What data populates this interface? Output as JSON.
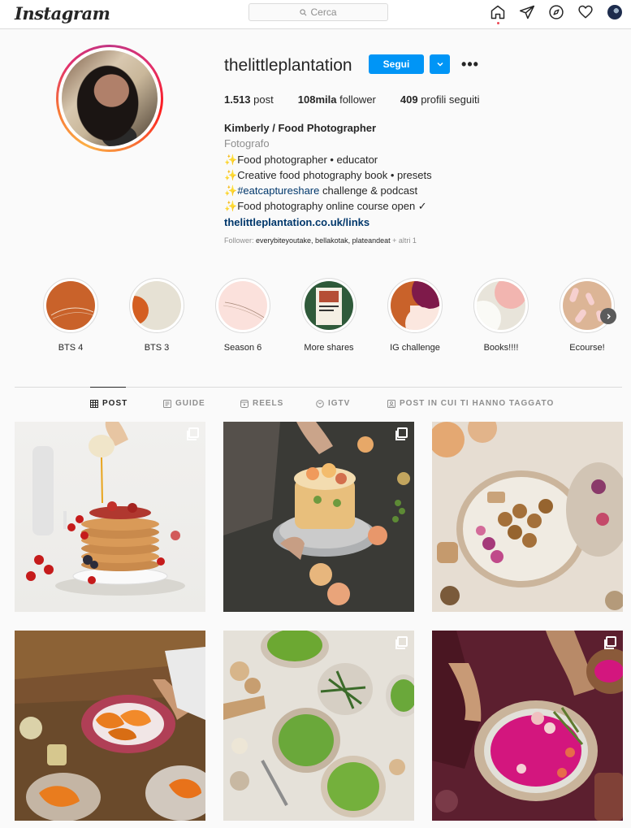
{
  "app": {
    "logo_text": "Instagram",
    "search_placeholder": "Cerca"
  },
  "nav": {
    "icons": [
      "home-icon",
      "direct-message-icon",
      "explore-icon",
      "activity-heart-icon",
      "profile-avatar"
    ]
  },
  "profile": {
    "username": "thelittleplantation",
    "follow_label": "Segui",
    "stats": {
      "posts_value": "1.513",
      "posts_label": "post",
      "followers_value": "108mila",
      "followers_label": "follower",
      "following_value": "409",
      "following_label": "profili seguiti"
    },
    "bio": {
      "name": "Kimberly / Food Photographer",
      "category": "Fotografo",
      "line1": "Food photographer • educator",
      "line2": "Creative food photography book • presets",
      "line3_hashtag": "#eatcaptureshare",
      "line3_rest": " challenge & podcast",
      "line4": "Food photography online course open ✓",
      "link": "thelittleplantation.co.uk/links",
      "sparkle": "✨"
    },
    "followed_by": {
      "prefix": "Follower: ",
      "names": "everybiteyoutake, bellakotak, plateandeat",
      "suffix": " + altri 1"
    }
  },
  "highlights": [
    {
      "label": "BTS 4"
    },
    {
      "label": "BTS 3"
    },
    {
      "label": "Season 6"
    },
    {
      "label": "More shares"
    },
    {
      "label": "IG challenge"
    },
    {
      "label": "Books!!!!"
    },
    {
      "label": "Ecourse!"
    }
  ],
  "tabs": [
    {
      "label": "POST",
      "icon": "grid-icon",
      "active": true
    },
    {
      "label": "GUIDE",
      "icon": "guide-icon",
      "active": false
    },
    {
      "label": "REELS",
      "icon": "reels-icon",
      "active": false
    },
    {
      "label": "IGTV",
      "icon": "igtv-icon",
      "active": false
    },
    {
      "label": "POST IN CUI TI HANNO TAGGATO",
      "icon": "tagged-icon",
      "active": false
    }
  ],
  "posts": [
    {
      "subject": "pancakes with berries and syrup",
      "multi": true
    },
    {
      "subject": "layered cake with fruit",
      "multi": true
    },
    {
      "subject": "falafel bowl",
      "multi": false
    },
    {
      "subject": "pasta with orange sauce",
      "multi": false
    },
    {
      "subject": "green soup bowls",
      "multi": true
    },
    {
      "subject": "pink beet hummus",
      "multi": true
    }
  ],
  "colors": {
    "accent": "#0095f6",
    "link": "#00376b",
    "text": "#262626",
    "muted": "#8e8e8e",
    "border": "#dbdbdb",
    "background": "#fafafa"
  }
}
